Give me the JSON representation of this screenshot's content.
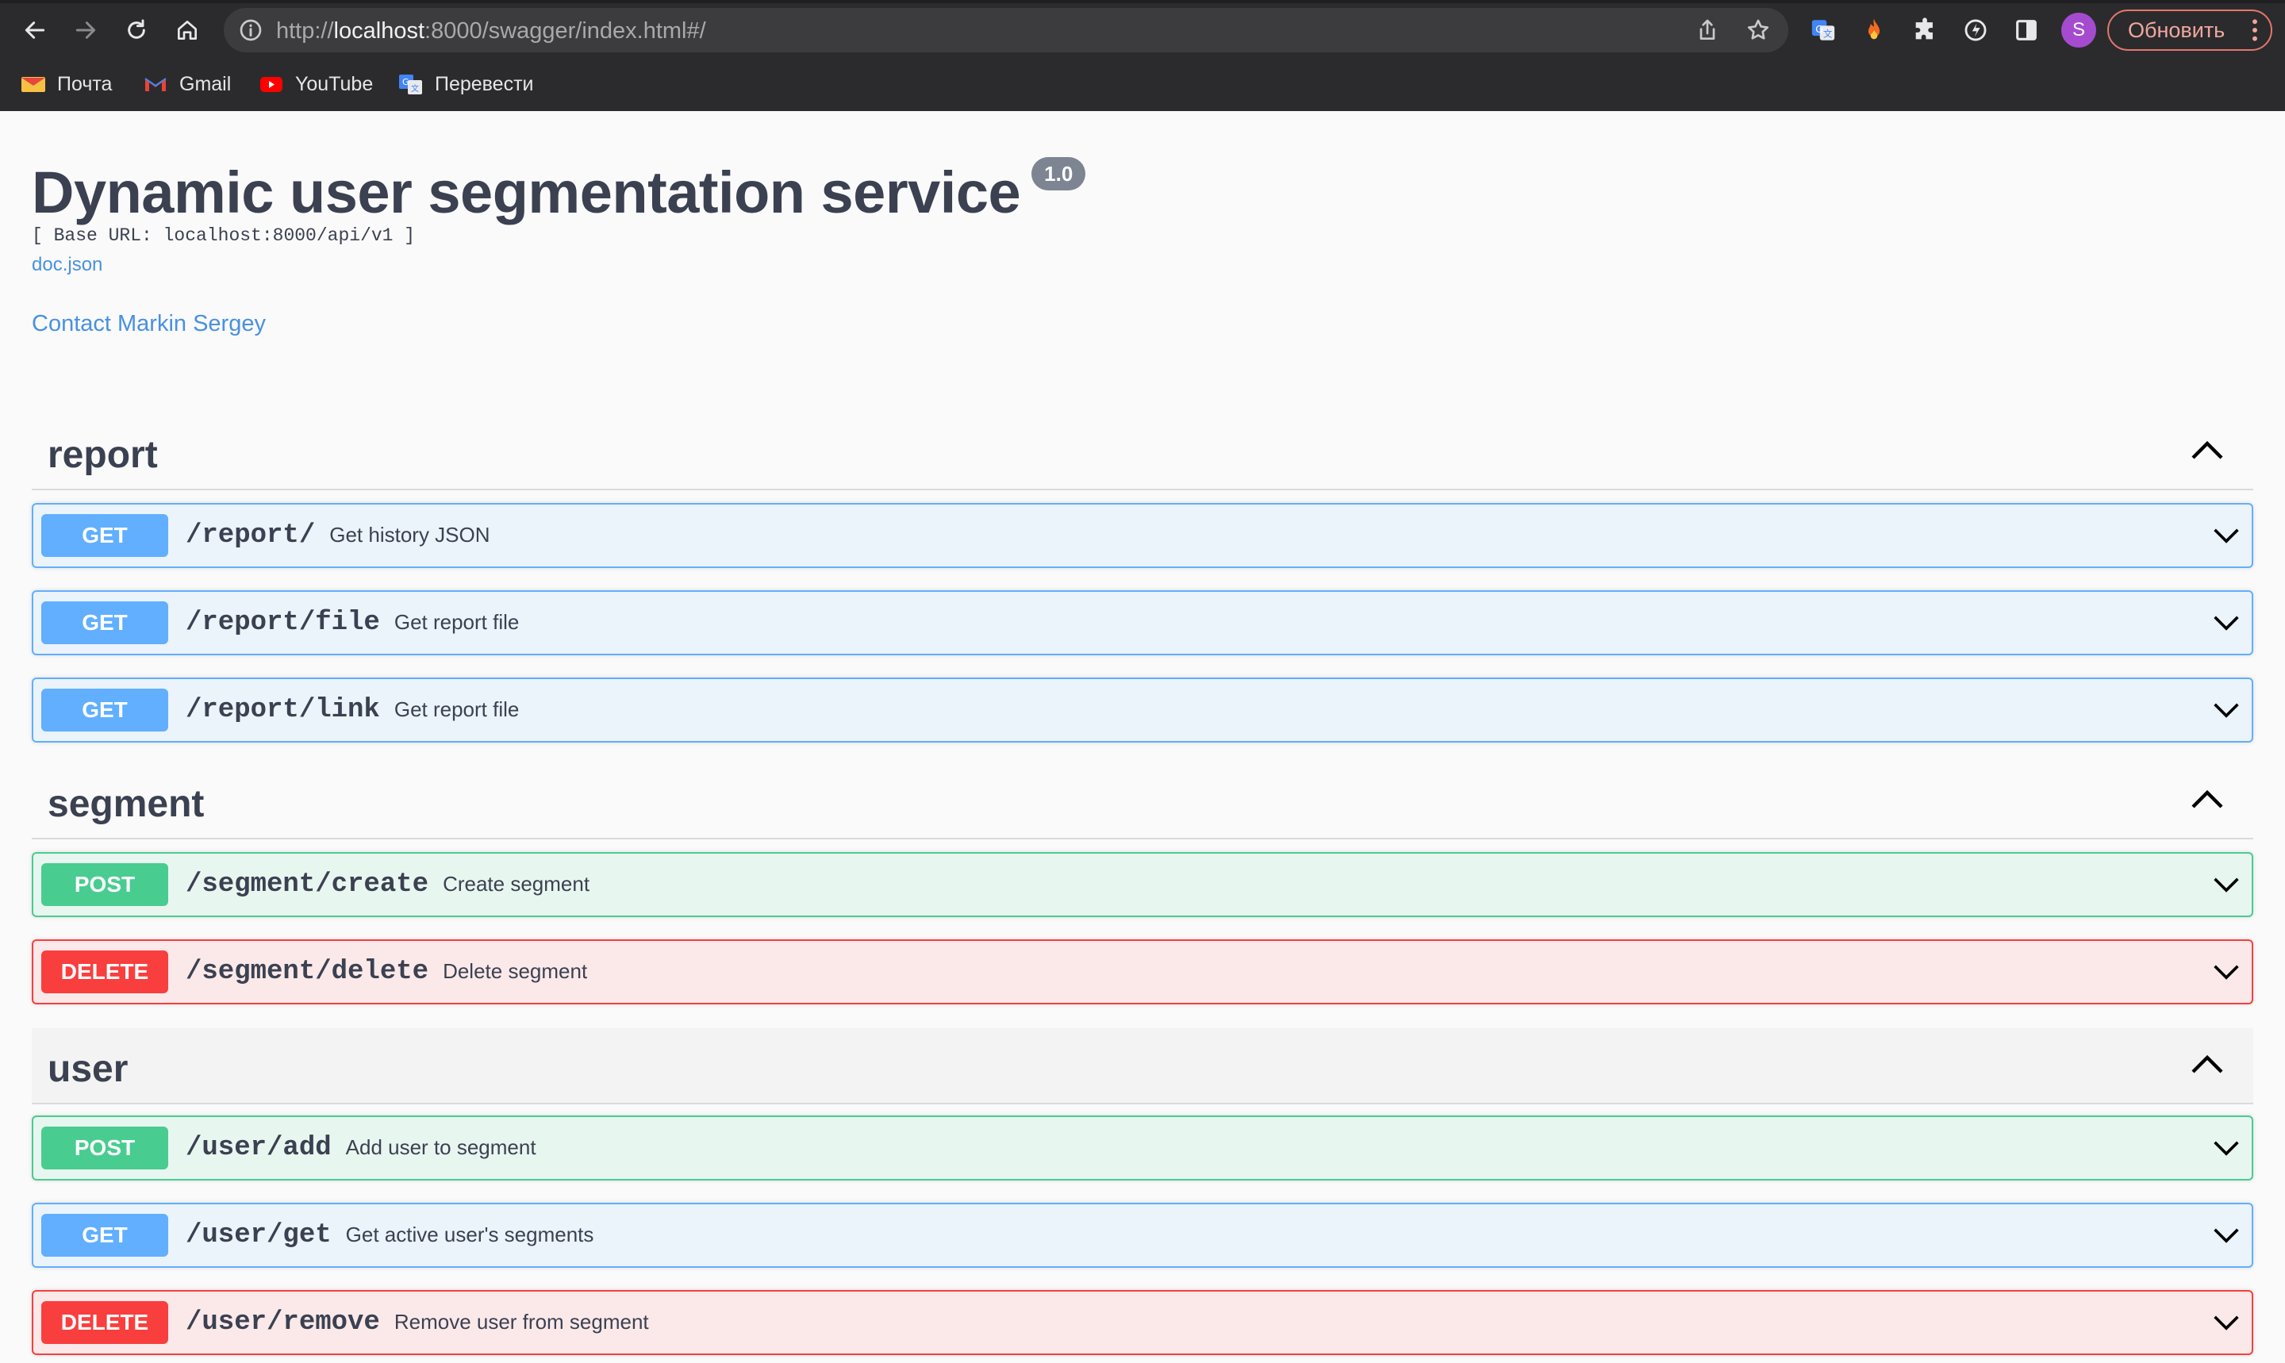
{
  "browser": {
    "url_prefix": "http://",
    "url_host": "localhost",
    "url_rest": ":8000/swagger/index.html#/",
    "profile_initial": "S",
    "update_label": "Обновить",
    "bookmarks": [
      {
        "label": "Почта",
        "icon": "mail-icon"
      },
      {
        "label": "Gmail",
        "icon": "gmail-icon"
      },
      {
        "label": "YouTube",
        "icon": "youtube-icon"
      },
      {
        "label": "Перевести",
        "icon": "translate-icon"
      }
    ]
  },
  "info": {
    "title": "Dynamic user segmentation service",
    "version": "1.0",
    "base_url": "[ Base URL: localhost:8000/api/v1 ]",
    "doc_link": "doc.json",
    "contact": "Contact Markin Sergey"
  },
  "tags": [
    {
      "name": "report",
      "operations": [
        {
          "method": "GET",
          "path": "/report/",
          "summary": "Get history JSON"
        },
        {
          "method": "GET",
          "path": "/report/file",
          "summary": "Get report file"
        },
        {
          "method": "GET",
          "path": "/report/link",
          "summary": "Get report file"
        }
      ]
    },
    {
      "name": "segment",
      "operations": [
        {
          "method": "POST",
          "path": "/segment/create",
          "summary": "Create segment"
        },
        {
          "method": "DELETE",
          "path": "/segment/delete",
          "summary": "Delete segment"
        }
      ]
    },
    {
      "name": "user",
      "operations": [
        {
          "method": "POST",
          "path": "/user/add",
          "summary": "Add user to segment"
        },
        {
          "method": "GET",
          "path": "/user/get",
          "summary": "Get active user's segments"
        },
        {
          "method": "DELETE",
          "path": "/user/remove",
          "summary": "Remove user from segment"
        }
      ]
    }
  ],
  "colors": {
    "get": "#61affe",
    "post": "#49cc90",
    "delete": "#f93e3e",
    "link": "#4990e2",
    "text": "#3b4151"
  }
}
